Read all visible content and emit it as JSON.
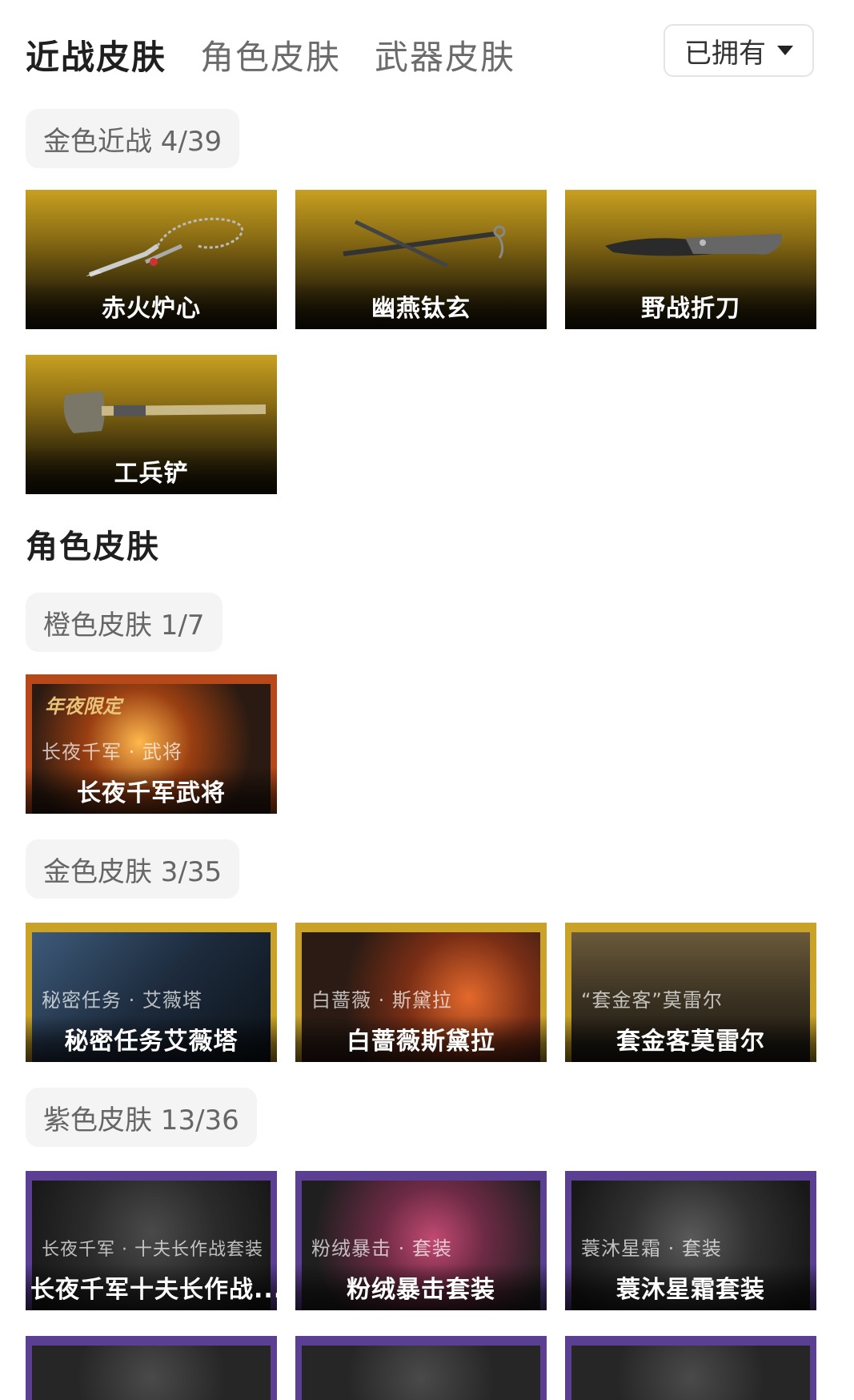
{
  "tabs": [
    {
      "label": "近战皮肤",
      "active": true
    },
    {
      "label": "角色皮肤",
      "active": false
    },
    {
      "label": "武器皮肤",
      "active": false
    }
  ],
  "filter": {
    "label": "已拥有"
  },
  "sections": {
    "melee_gold": {
      "chip": "金色近战 4/39",
      "items": [
        {
          "name": "赤火炉心",
          "icon": "chain-dart-icon"
        },
        {
          "name": "幽燕钛玄",
          "icon": "chain-whip-icon"
        },
        {
          "name": "野战折刀",
          "icon": "folding-knife-icon"
        },
        {
          "name": "工兵铲",
          "icon": "shovel-icon"
        }
      ]
    },
    "character_title": "角色皮肤",
    "orange": {
      "chip": "橙色皮肤 1/7",
      "items": [
        {
          "name": "长夜千军武将",
          "sublabel": "长夜千军 · 武将",
          "badge": "年夜限定"
        }
      ]
    },
    "gold": {
      "chip": "金色皮肤 3/35",
      "items": [
        {
          "name": "秘密任务艾薇塔",
          "sublabel": "秘密任务 · 艾薇塔"
        },
        {
          "name": "白蔷薇斯黛拉",
          "sublabel": "白蔷薇 · 斯黛拉"
        },
        {
          "name": "套金客莫雷尔",
          "sublabel": "“套金客”莫雷尔"
        }
      ]
    },
    "purple": {
      "chip": "紫色皮肤 13/36",
      "items": [
        {
          "name": "长夜千军十夫长作战...",
          "sublabel": "长夜千军 · 十夫长作战套装"
        },
        {
          "name": "粉绒暴击套装",
          "sublabel": "粉绒暴击 · 套装"
        },
        {
          "name": "蓑沐星霜套装",
          "sublabel": "蓑沐星霜 · 套装"
        }
      ]
    }
  },
  "colors": {
    "gold": "#c9a227",
    "orange": "#b6481a",
    "purple": "#5a3f93"
  }
}
